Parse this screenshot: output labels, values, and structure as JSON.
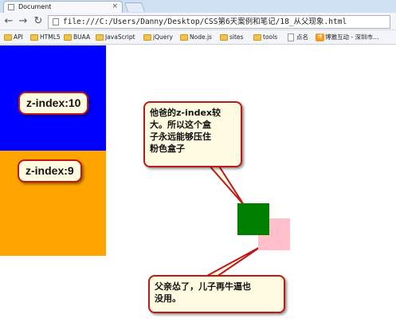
{
  "browser": {
    "tab_title": "Document",
    "tab_close": "×",
    "address": "file:///C:/Users/Danny/Desktop/CSS第6天案例和笔记/18_从父现象.html",
    "back_icon": "←",
    "forward_icon": "→",
    "reload_icon": "↻"
  },
  "bookmarks": [
    {
      "label": "API",
      "icon": "folder-icon"
    },
    {
      "label": "HTML5",
      "icon": "folder-icon"
    },
    {
      "label": "BUAA",
      "icon": "folder-icon"
    },
    {
      "label": "JavaScript",
      "icon": "folder-icon"
    },
    {
      "label": "jQuery",
      "icon": "folder-icon"
    },
    {
      "label": "Node.js",
      "icon": "folder-icon"
    },
    {
      "label": "sites",
      "icon": "folder-icon"
    },
    {
      "label": "tools",
      "icon": "folder-icon"
    },
    {
      "label": "点名",
      "icon": "page-icon"
    },
    {
      "label": "博雅互动 - 深圳市…",
      "icon": "badge-icon",
      "badge": "博"
    }
  ],
  "page": {
    "blue_label": "z-index:10",
    "orange_label": "z-index:9",
    "note_top": "他爸的z-index较\n大。所以这个盒\n子永远能够压住\n粉色盒子",
    "note_bottom": "父亲怂了，儿子再牛逼也\n没用。",
    "colors": {
      "blue_box": "#0000ff",
      "orange_box": "#ffa500",
      "green_square": "#008000",
      "pink_square": "#ffc0cb",
      "callout_border": "#c01818",
      "callout_fill": "#fffbe0"
    }
  }
}
